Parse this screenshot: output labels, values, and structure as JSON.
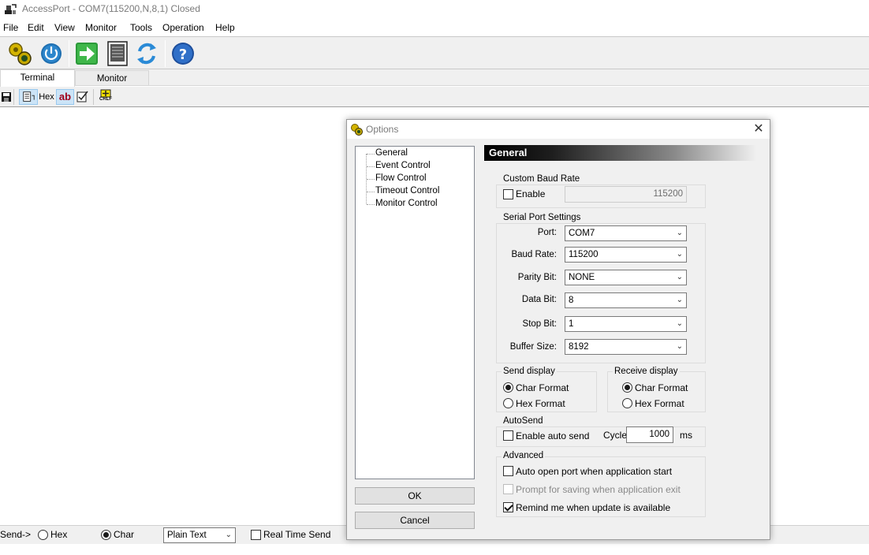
{
  "window": {
    "title": "AccessPort - COM7(115200,N,8,1) Closed"
  },
  "menu": [
    "File",
    "Edit",
    "View",
    "Monitor",
    "Tools",
    "Operation",
    "Help"
  ],
  "tabs": {
    "terminal": "Terminal",
    "monitor": "Monitor"
  },
  "subtoolbar": {
    "hex_label": "Hex",
    "ab_label": "ab",
    "crlf_label": "CRLF"
  },
  "sendbar": {
    "send_label": "Send->",
    "hex_label": "Hex",
    "char_label": "Char",
    "char_selected": true,
    "format_value": "Plain Text",
    "realtime_label": "Real Time Send",
    "realtime_checked": false
  },
  "dialog": {
    "title": "Options",
    "tree": [
      "General",
      "Event Control",
      "Flow Control",
      "Timeout Control",
      "Monitor Control"
    ],
    "ok_label": "OK",
    "cancel_label": "Cancel",
    "section_header": "General",
    "custom_baud": {
      "title": "Custom Baud Rate",
      "enable_label": "Enable",
      "enable_checked": false,
      "value": "115200"
    },
    "serial": {
      "title": "Serial Port Settings",
      "port_label": "Port:",
      "port_value": "COM7",
      "baud_label": "Baud Rate:",
      "baud_value": "115200",
      "parity_label": "Parity Bit:",
      "parity_value": "NONE",
      "data_label": "Data Bit:",
      "data_value": "8",
      "stop_label": "Stop Bit:",
      "stop_value": "1",
      "buffer_label": "Buffer Size:",
      "buffer_value": "8192"
    },
    "send_display": {
      "title": "Send display",
      "char_label": "Char Format",
      "hex_label": "Hex  Format",
      "selected": "char"
    },
    "receive_display": {
      "title": "Receive display",
      "char_label": "Char Format",
      "hex_label": "Hex  Format",
      "selected": "char"
    },
    "autosend": {
      "title": "AutoSend",
      "enable_label": "Enable auto send",
      "enable_checked": false,
      "cycle_label": "Cycle",
      "cycle_value": "1000",
      "unit": "ms"
    },
    "advanced": {
      "title": "Advanced",
      "auto_open_label": "Auto open port when application start",
      "auto_open_checked": false,
      "prompt_save_label": "Prompt for saving when application exit",
      "prompt_save_checked": false,
      "remind_label": "Remind me when update is available",
      "remind_checked": true
    }
  }
}
